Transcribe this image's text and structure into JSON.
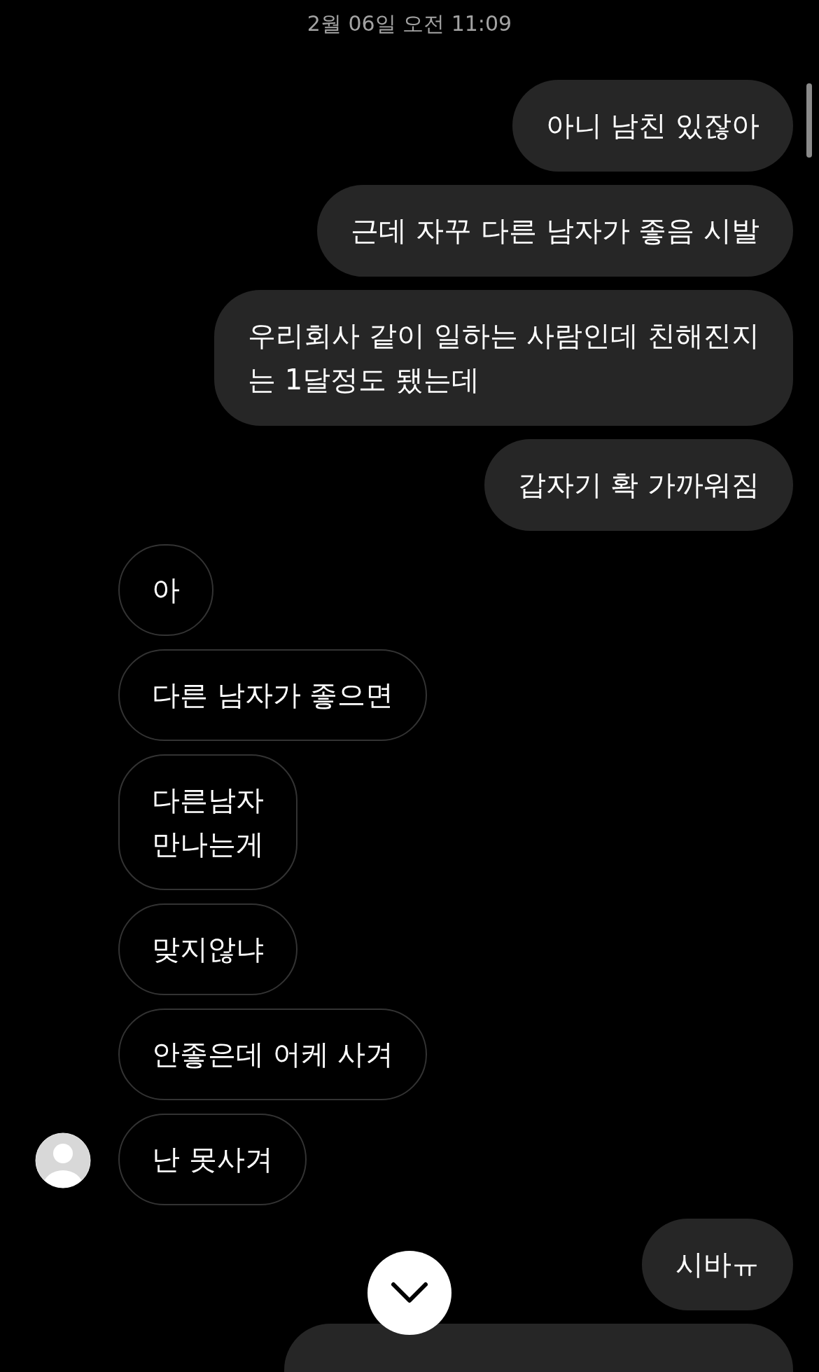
{
  "timestamp": "2월 06일 오전 11:09",
  "messages": [
    {
      "kind": "outgoing",
      "text": "아니 남친 있잖아"
    },
    {
      "kind": "outgoing",
      "text": "근데 자꾸 다른 남자가 좋음 시발"
    },
    {
      "kind": "outgoing",
      "text": "우리회사 같이 일하는 사람인데 친해진지\n는 1달정도 됐는데"
    },
    {
      "kind": "outgoing",
      "text": "갑자기 확 가까워짐"
    },
    {
      "kind": "incoming",
      "text": "아",
      "avatar": false
    },
    {
      "kind": "incoming",
      "text": "다른 남자가 좋으면",
      "avatar": false
    },
    {
      "kind": "incoming",
      "text": "다른남자\n만나는게",
      "avatar": false
    },
    {
      "kind": "incoming",
      "text": "맞지않냐",
      "avatar": false
    },
    {
      "kind": "incoming",
      "text": "안좋은데 어케 사겨",
      "avatar": false
    },
    {
      "kind": "incoming",
      "text": "난 못사겨",
      "avatar": true
    },
    {
      "kind": "outgoing",
      "text": "시바ㅠ"
    }
  ]
}
